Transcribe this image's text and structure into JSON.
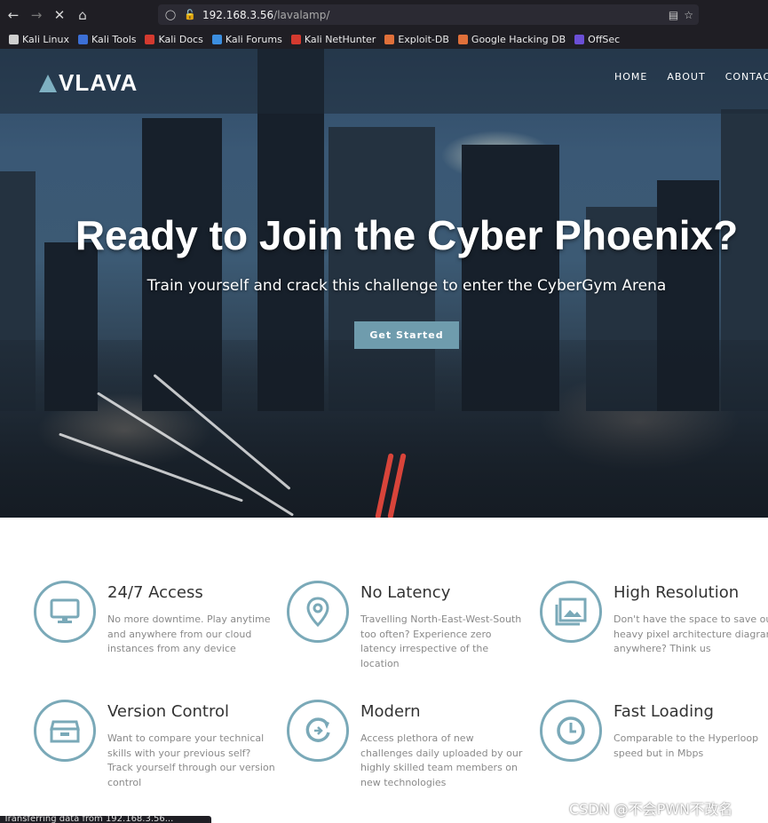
{
  "browser": {
    "url_host": "192.168.3.56",
    "url_path": "/lavalamp/",
    "bookmarks": [
      {
        "label": "Kali Linux",
        "color": "#cfcfcf"
      },
      {
        "label": "Kali Tools",
        "color": "#3c6fd6"
      },
      {
        "label": "Kali Docs",
        "color": "#d43a2f"
      },
      {
        "label": "Kali Forums",
        "color": "#3c8fe0"
      },
      {
        "label": "Kali NetHunter",
        "color": "#d43a2f"
      },
      {
        "label": "Exploit-DB",
        "color": "#e0703a"
      },
      {
        "label": "Google Hacking DB",
        "color": "#e0703a"
      },
      {
        "label": "OffSec",
        "color": "#6b4fd6"
      }
    ],
    "status": "Transferring data from 192.168.3.56..."
  },
  "site": {
    "logo": "VLAVA",
    "menu": [
      "HOME",
      "ABOUT",
      "CONTACT"
    ],
    "hero_title": "Ready to Join the Cyber Phoenix?",
    "hero_subtitle": "Train yourself and crack this challenge to enter the CyberGym Arena",
    "cta": "Get Started"
  },
  "features": [
    {
      "title": "24/7 Access",
      "desc": "No more downtime. Play anytime and anywhere from our cloud instances from any device",
      "icon": "monitor-icon"
    },
    {
      "title": "No Latency",
      "desc": "Travelling North-East-West-South too often? Experience zero latency irrespective of the location",
      "icon": "map-pin-icon"
    },
    {
      "title": "High Resolution",
      "desc": "Don't have the space to save our heavy pixel architecture diagrams anywhere? Think us",
      "icon": "image-icon"
    },
    {
      "title": "Version Control",
      "desc": "Want to compare your technical skills with your previous self? Track yourself through our version control",
      "icon": "archive-icon"
    },
    {
      "title": "Modern",
      "desc": "Access plethora of new challenges daily uploaded by our highly skilled team members on new technologies",
      "icon": "refresh-icon"
    },
    {
      "title": "Fast Loading",
      "desc": "Comparable to the Hyperloop speed but in Mbps",
      "icon": "clock-icon"
    }
  ],
  "watermark": "CSDN @不会PWN不改名",
  "colors": {
    "accent": "#7aa9b8",
    "cta": "#6f9cad",
    "chrome": "#1f1e24"
  }
}
